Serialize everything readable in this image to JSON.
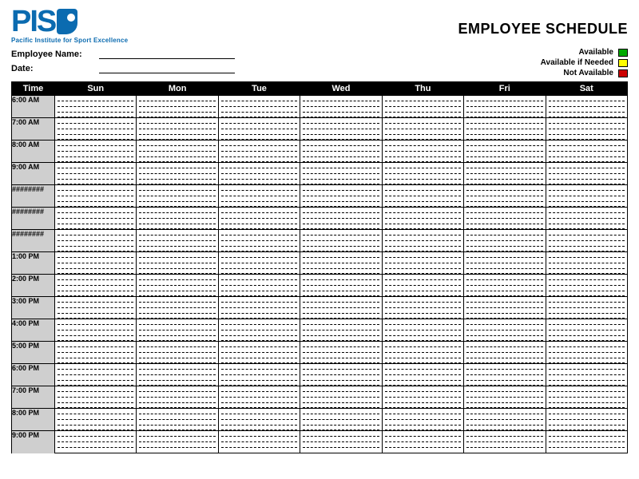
{
  "logo": {
    "text_left": "PIS",
    "text_right": "",
    "subline": "Pacific Institute for Sport Excellence"
  },
  "title": "EMPLOYEE SCHEDULE",
  "fields": {
    "name_label": "Employee Name:",
    "date_label": "Date:"
  },
  "legend": [
    {
      "label": "Available",
      "color": "green"
    },
    {
      "label": "Available if Needed",
      "color": "yellow"
    },
    {
      "label": "Not Available",
      "color": "red"
    }
  ],
  "columns": [
    "Time",
    "Sun",
    "Mon",
    "Tue",
    "Wed",
    "Thu",
    "Fri",
    "Sat"
  ],
  "time_labels": [
    "6:00 AM",
    "7:00 AM",
    "8:00 AM",
    "9:00 AM",
    "########",
    "########",
    "########",
    "1:00 PM",
    "2:00 PM",
    "3:00 PM",
    "4:00 PM",
    "5:00 PM",
    "6:00 PM",
    "7:00 PM",
    "8:00 PM",
    "9:00 PM"
  ],
  "subdivisions_per_hour": 4
}
